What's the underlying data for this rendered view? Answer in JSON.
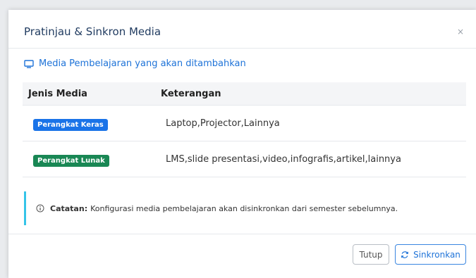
{
  "modal": {
    "title": "Pratinjau & Sinkron Media",
    "close_icon": "×"
  },
  "section": {
    "icon": "monitor-icon",
    "title": "Media Pembelajaran yang akan ditambahkan"
  },
  "table": {
    "headers": [
      "Jenis Media",
      "Keterangan"
    ],
    "rows": [
      {
        "badge": "Perangkat Keras",
        "badge_color": "#1a73e8",
        "desc": "Laptop,Projector,Lainnya"
      },
      {
        "badge": "Perangkat Lunak",
        "badge_color": "#198754",
        "desc": "LMS,slide presentasi,video,infografis,artikel,lainnya"
      }
    ]
  },
  "note": {
    "icon": "info-icon",
    "label": "Catatan:",
    "text": "Konfigurasi media pembelajaran akan disinkronkan dari semester sebelumnya."
  },
  "footer": {
    "close_label": "Tutup",
    "sync_label": "Sinkronkan",
    "sync_icon": "refresh-icon"
  }
}
